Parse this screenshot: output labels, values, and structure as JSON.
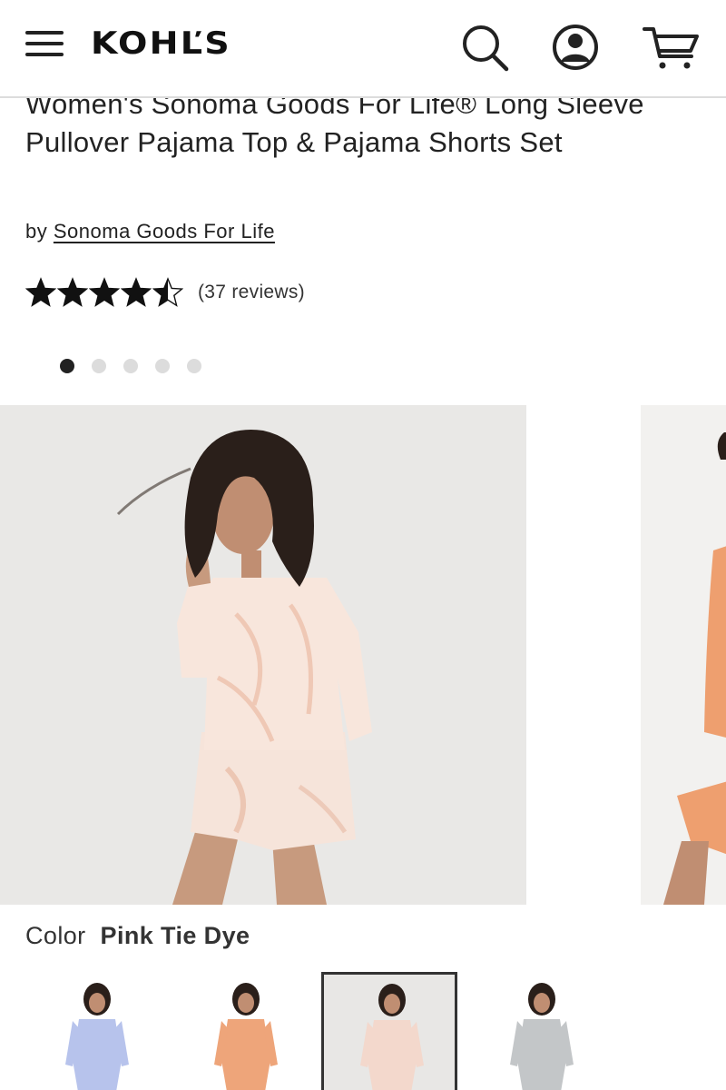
{
  "header": {
    "logo_text": "KOHĽS",
    "icons": [
      "menu-icon",
      "search-icon",
      "account-icon",
      "cart-icon"
    ]
  },
  "product": {
    "title": "Women's Sonoma Goods For Life® Long Sleeve Pullover Pajama Top & Pajama Shorts Set",
    "brand_prefix": "by",
    "brand_name": "Sonoma Goods For Life",
    "rating_stars": 4.5,
    "rating_max": 5,
    "reviews_text": "(37 reviews)"
  },
  "carousel": {
    "slide_count": 5,
    "active_index": 0
  },
  "color": {
    "label": "Color",
    "selected": "Pink Tie Dye",
    "swatches": [
      {
        "name": "Periwinkle",
        "color": "#b7c3ec",
        "selected": false
      },
      {
        "name": "Orange",
        "color": "#eea57a",
        "selected": false
      },
      {
        "name": "Pink Tie Dye",
        "color": "#f3d8cc",
        "selected": true
      },
      {
        "name": "Gray",
        "color": "#c3c6c8",
        "selected": false
      }
    ]
  },
  "colors": {
    "accent": "#222222",
    "dot_inactive": "#dcdcdc",
    "image_bg": "#e9e8e6"
  }
}
